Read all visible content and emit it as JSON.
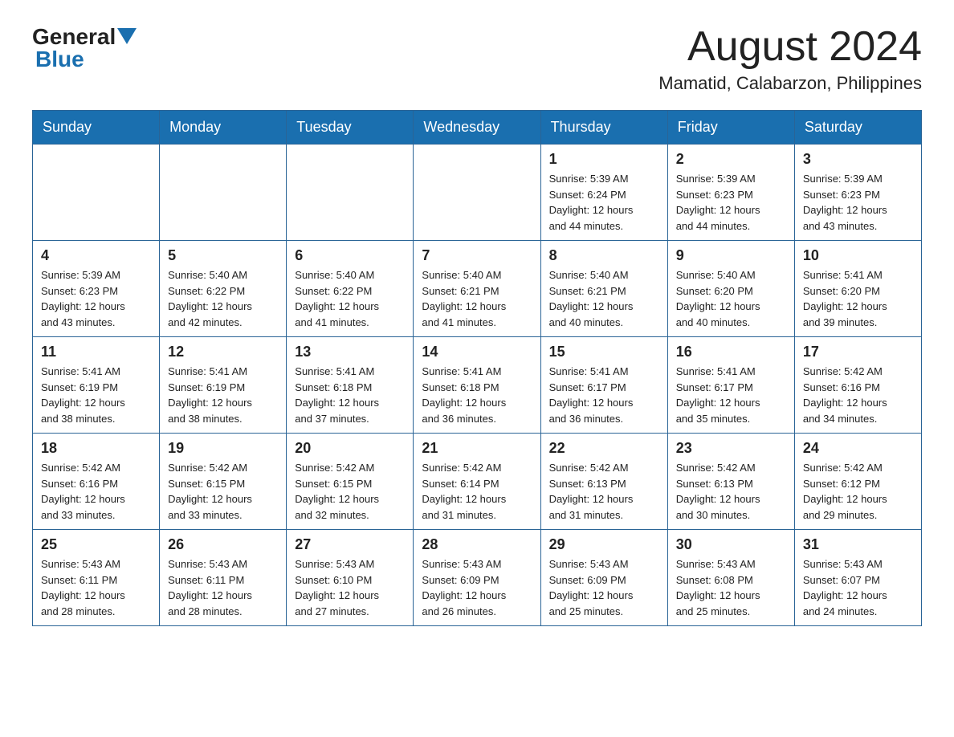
{
  "header": {
    "logo_general": "General",
    "logo_blue": "Blue",
    "month_title": "August 2024",
    "location": "Mamatid, Calabarzon, Philippines"
  },
  "days_of_week": [
    "Sunday",
    "Monday",
    "Tuesday",
    "Wednesday",
    "Thursday",
    "Friday",
    "Saturday"
  ],
  "weeks": [
    [
      {
        "day": "",
        "info": ""
      },
      {
        "day": "",
        "info": ""
      },
      {
        "day": "",
        "info": ""
      },
      {
        "day": "",
        "info": ""
      },
      {
        "day": "1",
        "info": "Sunrise: 5:39 AM\nSunset: 6:24 PM\nDaylight: 12 hours\nand 44 minutes."
      },
      {
        "day": "2",
        "info": "Sunrise: 5:39 AM\nSunset: 6:23 PM\nDaylight: 12 hours\nand 44 minutes."
      },
      {
        "day": "3",
        "info": "Sunrise: 5:39 AM\nSunset: 6:23 PM\nDaylight: 12 hours\nand 43 minutes."
      }
    ],
    [
      {
        "day": "4",
        "info": "Sunrise: 5:39 AM\nSunset: 6:23 PM\nDaylight: 12 hours\nand 43 minutes."
      },
      {
        "day": "5",
        "info": "Sunrise: 5:40 AM\nSunset: 6:22 PM\nDaylight: 12 hours\nand 42 minutes."
      },
      {
        "day": "6",
        "info": "Sunrise: 5:40 AM\nSunset: 6:22 PM\nDaylight: 12 hours\nand 41 minutes."
      },
      {
        "day": "7",
        "info": "Sunrise: 5:40 AM\nSunset: 6:21 PM\nDaylight: 12 hours\nand 41 minutes."
      },
      {
        "day": "8",
        "info": "Sunrise: 5:40 AM\nSunset: 6:21 PM\nDaylight: 12 hours\nand 40 minutes."
      },
      {
        "day": "9",
        "info": "Sunrise: 5:40 AM\nSunset: 6:20 PM\nDaylight: 12 hours\nand 40 minutes."
      },
      {
        "day": "10",
        "info": "Sunrise: 5:41 AM\nSunset: 6:20 PM\nDaylight: 12 hours\nand 39 minutes."
      }
    ],
    [
      {
        "day": "11",
        "info": "Sunrise: 5:41 AM\nSunset: 6:19 PM\nDaylight: 12 hours\nand 38 minutes."
      },
      {
        "day": "12",
        "info": "Sunrise: 5:41 AM\nSunset: 6:19 PM\nDaylight: 12 hours\nand 38 minutes."
      },
      {
        "day": "13",
        "info": "Sunrise: 5:41 AM\nSunset: 6:18 PM\nDaylight: 12 hours\nand 37 minutes."
      },
      {
        "day": "14",
        "info": "Sunrise: 5:41 AM\nSunset: 6:18 PM\nDaylight: 12 hours\nand 36 minutes."
      },
      {
        "day": "15",
        "info": "Sunrise: 5:41 AM\nSunset: 6:17 PM\nDaylight: 12 hours\nand 36 minutes."
      },
      {
        "day": "16",
        "info": "Sunrise: 5:41 AM\nSunset: 6:17 PM\nDaylight: 12 hours\nand 35 minutes."
      },
      {
        "day": "17",
        "info": "Sunrise: 5:42 AM\nSunset: 6:16 PM\nDaylight: 12 hours\nand 34 minutes."
      }
    ],
    [
      {
        "day": "18",
        "info": "Sunrise: 5:42 AM\nSunset: 6:16 PM\nDaylight: 12 hours\nand 33 minutes."
      },
      {
        "day": "19",
        "info": "Sunrise: 5:42 AM\nSunset: 6:15 PM\nDaylight: 12 hours\nand 33 minutes."
      },
      {
        "day": "20",
        "info": "Sunrise: 5:42 AM\nSunset: 6:15 PM\nDaylight: 12 hours\nand 32 minutes."
      },
      {
        "day": "21",
        "info": "Sunrise: 5:42 AM\nSunset: 6:14 PM\nDaylight: 12 hours\nand 31 minutes."
      },
      {
        "day": "22",
        "info": "Sunrise: 5:42 AM\nSunset: 6:13 PM\nDaylight: 12 hours\nand 31 minutes."
      },
      {
        "day": "23",
        "info": "Sunrise: 5:42 AM\nSunset: 6:13 PM\nDaylight: 12 hours\nand 30 minutes."
      },
      {
        "day": "24",
        "info": "Sunrise: 5:42 AM\nSunset: 6:12 PM\nDaylight: 12 hours\nand 29 minutes."
      }
    ],
    [
      {
        "day": "25",
        "info": "Sunrise: 5:43 AM\nSunset: 6:11 PM\nDaylight: 12 hours\nand 28 minutes."
      },
      {
        "day": "26",
        "info": "Sunrise: 5:43 AM\nSunset: 6:11 PM\nDaylight: 12 hours\nand 28 minutes."
      },
      {
        "day": "27",
        "info": "Sunrise: 5:43 AM\nSunset: 6:10 PM\nDaylight: 12 hours\nand 27 minutes."
      },
      {
        "day": "28",
        "info": "Sunrise: 5:43 AM\nSunset: 6:09 PM\nDaylight: 12 hours\nand 26 minutes."
      },
      {
        "day": "29",
        "info": "Sunrise: 5:43 AM\nSunset: 6:09 PM\nDaylight: 12 hours\nand 25 minutes."
      },
      {
        "day": "30",
        "info": "Sunrise: 5:43 AM\nSunset: 6:08 PM\nDaylight: 12 hours\nand 25 minutes."
      },
      {
        "day": "31",
        "info": "Sunrise: 5:43 AM\nSunset: 6:07 PM\nDaylight: 12 hours\nand 24 minutes."
      }
    ]
  ]
}
